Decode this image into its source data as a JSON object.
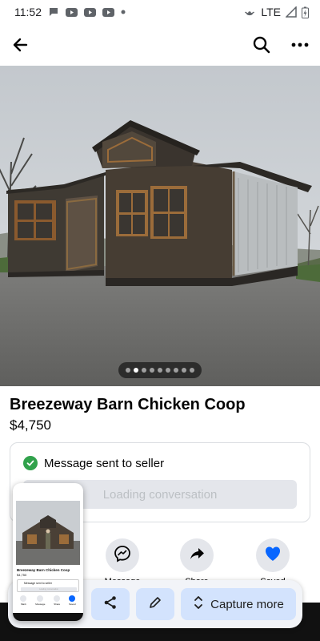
{
  "status_bar": {
    "time": "11:52",
    "network": "LTE",
    "icons": [
      "chat-bubble-icon",
      "youtube-icon",
      "youtube-icon",
      "youtube-icon",
      "dot-icon",
      "hotspot-icon",
      "signal-icon",
      "battery-charging-icon"
    ]
  },
  "app_bar": {
    "icons": [
      "back-arrow-icon",
      "search-icon",
      "more-icon"
    ]
  },
  "carousel": {
    "total": 9,
    "active_index": 1
  },
  "listing": {
    "title": "Breezeway Barn Chicken Coop",
    "price": "$4,750"
  },
  "message_card": {
    "status": "Message sent to seller",
    "loading_button": "Loading conversation"
  },
  "actions": [
    {
      "icon": "messenger-icon",
      "label": "Message"
    },
    {
      "icon": "share-icon",
      "label": "Share"
    },
    {
      "icon": "heart-icon",
      "label": "Saved"
    }
  ],
  "screenshot_toolbar": {
    "share_icon": "share-icon",
    "edit_icon": "pencil-icon",
    "capture_more_icon": "expand-vertical-icon",
    "capture_more_label": "Capture more"
  },
  "thumbnail": {
    "title": "Breezeway Barn Chicken Coop",
    "price": "$4,750",
    "msg": "Message sent to seller",
    "loading": "Loading conversation",
    "actions": [
      "Mark",
      "Message",
      "Share",
      "Saved"
    ]
  },
  "colors": {
    "accent_blue": "#0866ff",
    "success_green": "#31a24c",
    "chip_bg": "#e4e6eb",
    "toolbar_button": "#d3e3fd"
  }
}
